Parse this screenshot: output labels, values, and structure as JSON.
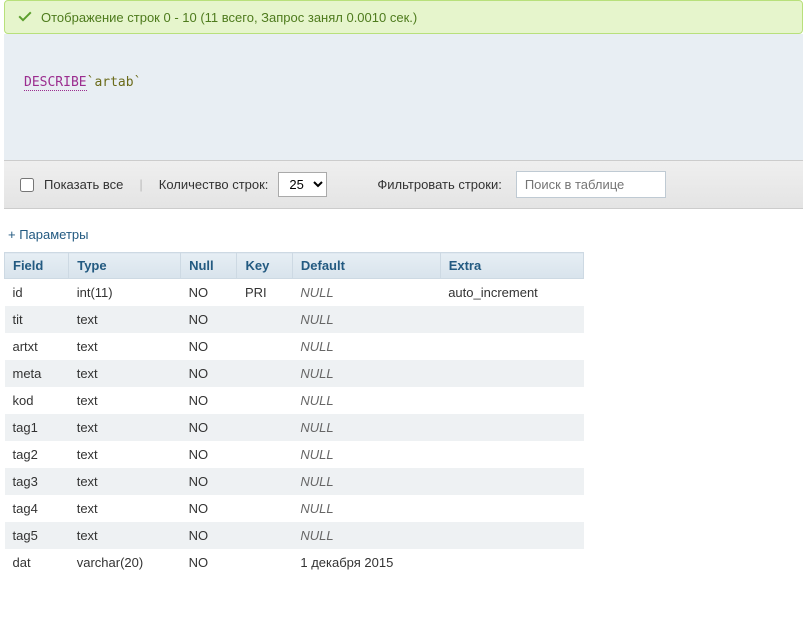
{
  "success": {
    "message": "Отображение строк 0 - 10 (11 всего, Запрос занял 0.0010 сек.)"
  },
  "sql": {
    "keyword": "DESCRIBE",
    "table": "`artab`"
  },
  "toolbar": {
    "show_all": "Показать все",
    "row_count_label": "Количество строк:",
    "row_count_value": "25",
    "filter_label": "Фильтровать строки:",
    "filter_placeholder": "Поиск в таблице"
  },
  "params_link": "+ Параметры",
  "table": {
    "headers": [
      "Field",
      "Type",
      "Null",
      "Key",
      "Default",
      "Extra"
    ],
    "rows": [
      {
        "field": "id",
        "type": "int(11)",
        "null": "NO",
        "key": "PRI",
        "default": null,
        "extra": "auto_increment"
      },
      {
        "field": "tit",
        "type": "text",
        "null": "NO",
        "key": "",
        "default": null,
        "extra": ""
      },
      {
        "field": "artxt",
        "type": "text",
        "null": "NO",
        "key": "",
        "default": null,
        "extra": ""
      },
      {
        "field": "meta",
        "type": "text",
        "null": "NO",
        "key": "",
        "default": null,
        "extra": ""
      },
      {
        "field": "kod",
        "type": "text",
        "null": "NO",
        "key": "",
        "default": null,
        "extra": ""
      },
      {
        "field": "tag1",
        "type": "text",
        "null": "NO",
        "key": "",
        "default": null,
        "extra": ""
      },
      {
        "field": "tag2",
        "type": "text",
        "null": "NO",
        "key": "",
        "default": null,
        "extra": ""
      },
      {
        "field": "tag3",
        "type": "text",
        "null": "NO",
        "key": "",
        "default": null,
        "extra": ""
      },
      {
        "field": "tag4",
        "type": "text",
        "null": "NO",
        "key": "",
        "default": null,
        "extra": ""
      },
      {
        "field": "tag5",
        "type": "text",
        "null": "NO",
        "key": "",
        "default": null,
        "extra": ""
      },
      {
        "field": "dat",
        "type": "varchar(20)",
        "null": "NO",
        "key": "",
        "default": "1 декабря 2015",
        "extra": ""
      }
    ]
  },
  "null_text": "NULL"
}
